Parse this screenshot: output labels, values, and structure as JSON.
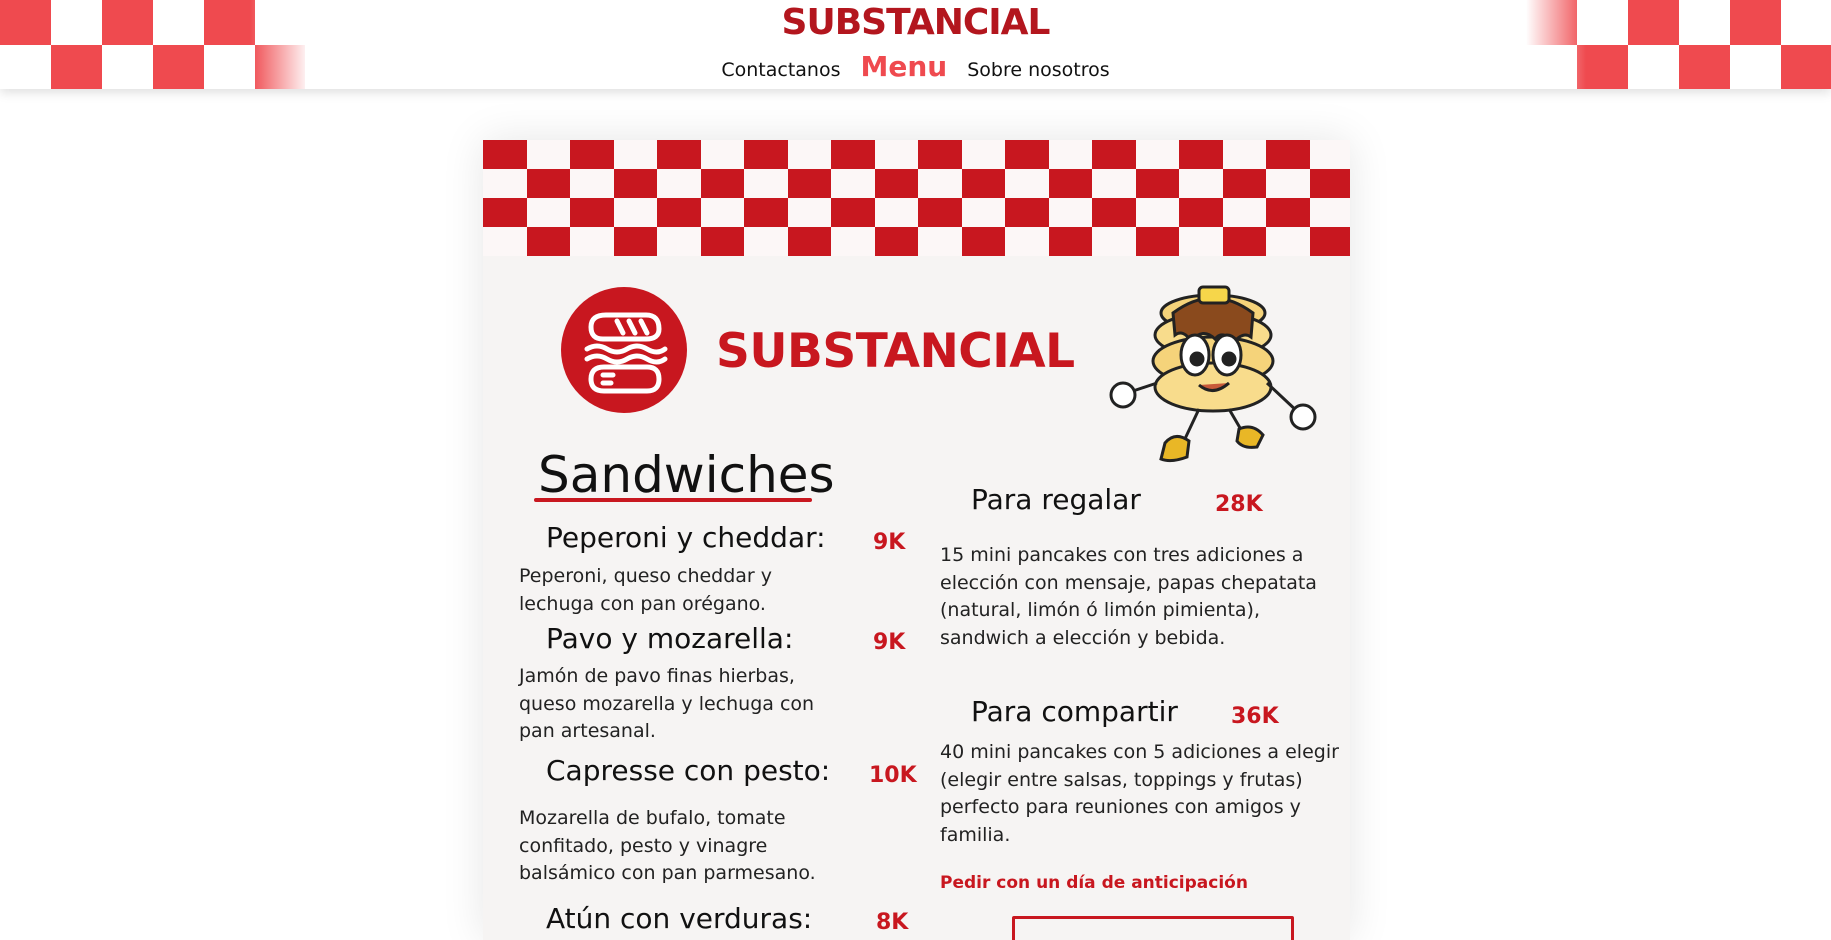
{
  "header": {
    "brand": "SUBSTANCIAL",
    "nav": [
      {
        "label": "Contactanos",
        "active": false
      },
      {
        "label": "Menu",
        "active": true
      },
      {
        "label": "Sobre nosotros",
        "active": false
      }
    ],
    "accent_color": "#ef4a4f",
    "brand_color": "#b3161e"
  },
  "menu_card": {
    "brand": "SUBSTANCIAL",
    "logo_icon": "sandwich-icon",
    "mascot_icon": "pancake-mascot-icon",
    "accent_color": "#c8171f",
    "sandwiches": {
      "title": "Sandwiches",
      "items": [
        {
          "name": "Peperoni y cheddar:",
          "price": "9K",
          "description": "Peperoni, queso cheddar y lechuga con pan orégano."
        },
        {
          "name": "Pavo y mozarella:",
          "price": "9K",
          "description": "Jamón de pavo finas hierbas, queso mozarella y lechuga con pan artesanal."
        },
        {
          "name": "Capresse con pesto:",
          "price": "10K",
          "description": "Mozarella de bufalo, tomate confitado, pesto y vinagre balsámico con pan parmesano."
        },
        {
          "name": "Atún con verduras:",
          "price": "8K",
          "description": ""
        }
      ]
    },
    "combos": [
      {
        "name": "Para regalar",
        "price": "28K",
        "description": "15 mini pancakes con tres adiciones a elección con mensaje, papas chepatata (natural, limón ó limón pimienta), sandwich a elección y bebida."
      },
      {
        "name": "Para compartir",
        "price": "36K",
        "description": "40 mini pancakes con 5 adiciones a elegir (elegir entre salsas, toppings y frutas) perfecto para reuniones con amigos y familia."
      }
    ],
    "note": "Pedir con un día de anticipación"
  }
}
